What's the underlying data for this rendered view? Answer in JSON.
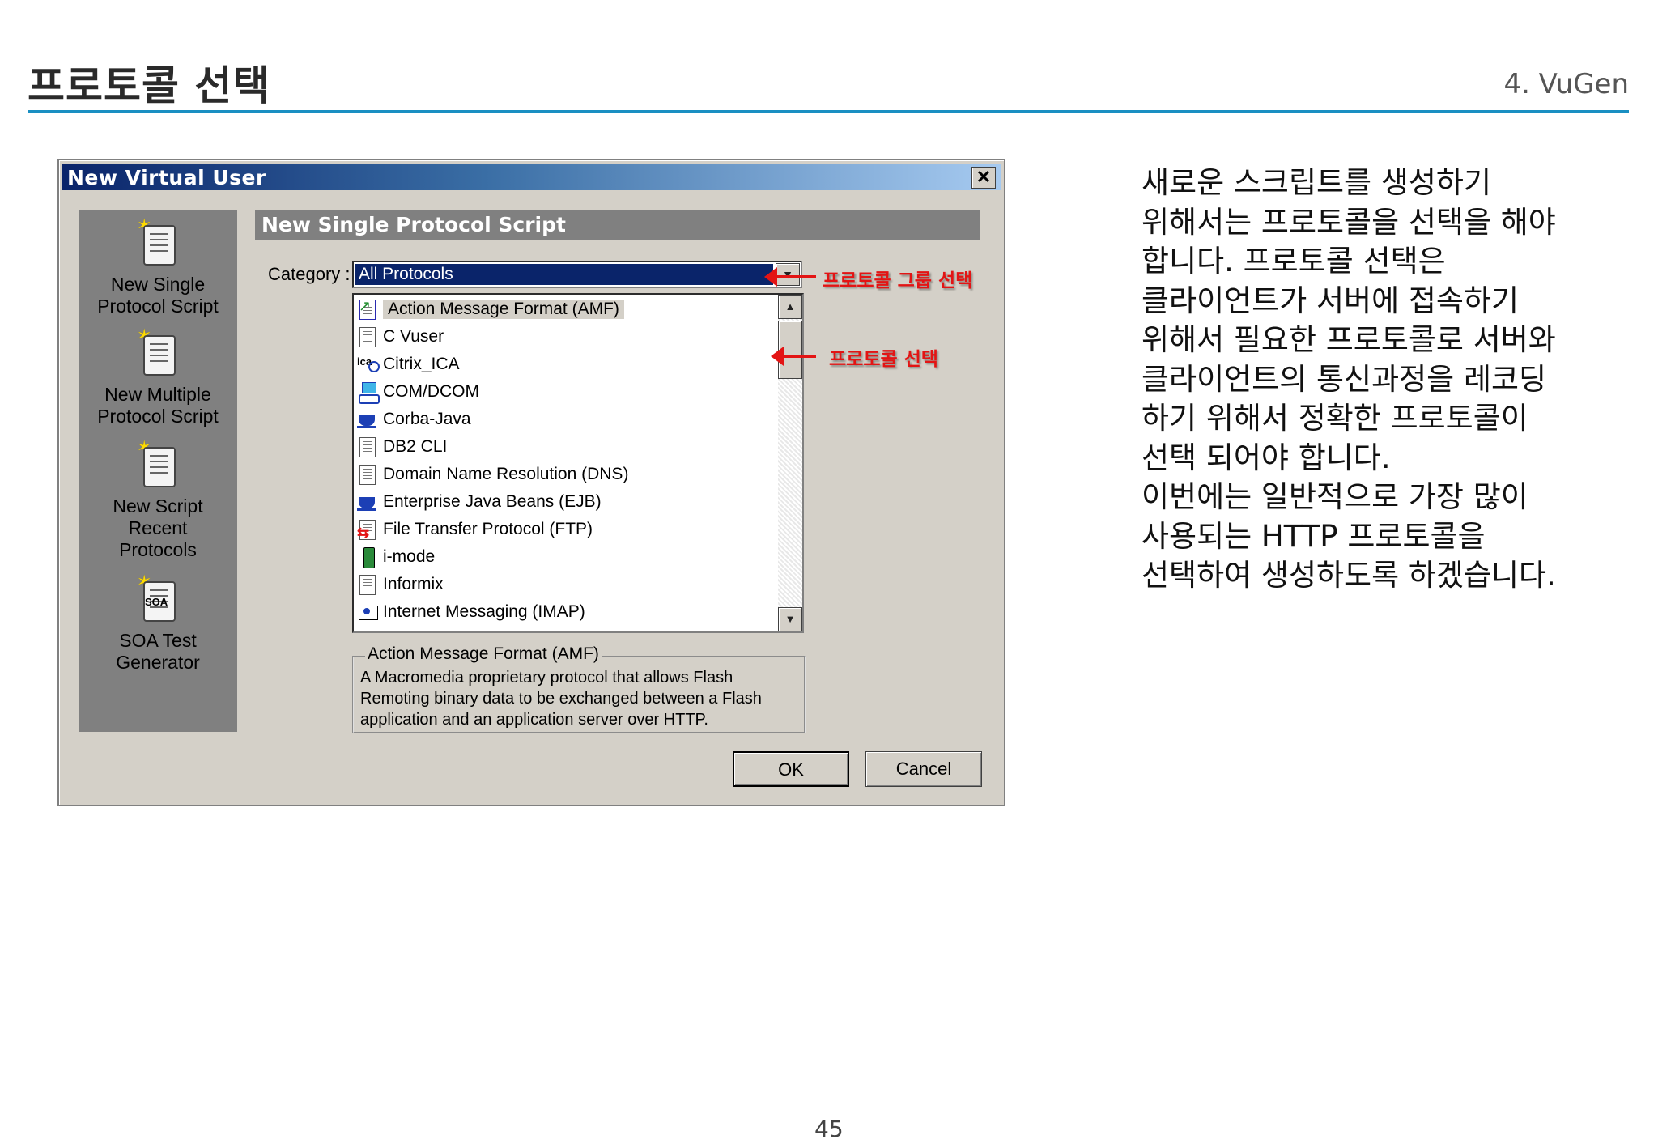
{
  "slide": {
    "title": "프로토콜 선택",
    "section": "4. VuGen",
    "page_number": "45"
  },
  "description_lines": [
    "새로운 스크립트를 생성하기",
    "위해서는 프로토콜을 선택을 해야",
    "합니다. 프로토콜 선택은",
    "클라이언트가 서버에 접속하기",
    "위해서 필요한 프로토콜로 서버와",
    "클라이언트의 통신과정을 레코딩",
    "하기 위해서 정확한 프로토콜이",
    "선택 되어야 합니다.",
    "이번에는 일반적으로 가장 많이",
    "사용되는 HTTP 프로토콜을",
    "선택하여 생성하도록 하겠습니다."
  ],
  "dialog": {
    "title": "New Virtual User",
    "close_glyph": "✕",
    "left_panel": [
      {
        "line1": "New Single",
        "line2": "Protocol Script",
        "icon": "new-single-script-icon"
      },
      {
        "line1": "New Multiple",
        "line2": "Protocol Script",
        "icon": "new-multiple-script-icon"
      },
      {
        "line1": "New Script",
        "line2": "Recent",
        "line3": "Protocols",
        "icon": "recent-protocols-icon"
      },
      {
        "line1": "SOA Test",
        "line2": "Generator",
        "icon": "soa-generator-icon",
        "tag": "SOA"
      }
    ],
    "panel_header": "New Single Protocol Script",
    "category_label": "Category :",
    "category_value": "All Protocols",
    "protocols": [
      {
        "label": "Action Message Format (AMF)",
        "icon": "amf-chart-icon",
        "selected": true
      },
      {
        "label": "C Vuser",
        "icon": "document-icon"
      },
      {
        "label": "Citrix_ICA",
        "icon": "citrix-ica-icon"
      },
      {
        "label": "COM/DCOM",
        "icon": "com-dcom-icon"
      },
      {
        "label": "Corba-Java",
        "icon": "java-cup-icon"
      },
      {
        "label": "DB2 CLI",
        "icon": "document-icon"
      },
      {
        "label": "Domain Name Resolution (DNS)",
        "icon": "document-icon"
      },
      {
        "label": "Enterprise Java Beans (EJB)",
        "icon": "java-cup-icon"
      },
      {
        "label": "File Transfer Protocol (FTP)",
        "icon": "ftp-transfer-icon"
      },
      {
        "label": "i-mode",
        "icon": "mobile-phone-icon"
      },
      {
        "label": "Informix",
        "icon": "document-icon"
      },
      {
        "label": "Internet Messaging (IMAP)",
        "icon": "imap-mail-icon"
      }
    ],
    "description_legend": "Action Message Format (AMF)",
    "description_text": "A Macromedia proprietary protocol that allows Flash Remoting binary data to be exchanged between a Flash application and an application server over HTTP.",
    "ok_label": "OK",
    "cancel_label": "Cancel"
  },
  "annotations": {
    "group_select": "프로토콜 그룹 선택",
    "protocol_select": "프로토콜 선택"
  },
  "colors": {
    "accent_rule": "#1a8fc2",
    "annotation_red": "#e31414",
    "titlebar_blue": "#0a246a"
  }
}
